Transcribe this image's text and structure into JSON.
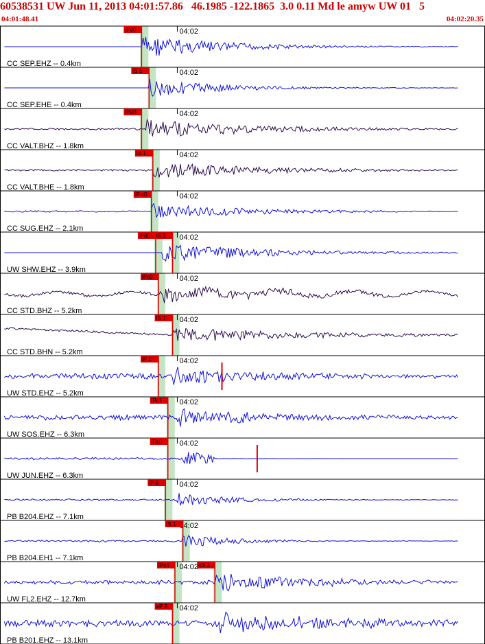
{
  "header": {
    "title": "60538531 UW Jun 11, 2013 04:01:57.86   46.1985 -122.1865  3.0 0.11 Md le amyw UW 01   5",
    "start_time": "04:01:48.41",
    "end_time": "04:02:20.35"
  },
  "colors": {
    "trace_blue": "#1010d8",
    "trace_dark": "#2a0a4a",
    "pick_red": "#dd0000",
    "window_green": "#b8e0b8",
    "grid_gray": "#808080"
  },
  "time_tick_label": "04:02",
  "traces": [
    {
      "label": "CC SEP.EHZ -- 0.4km",
      "color": "blue",
      "onset": 0.294,
      "amp": 0.62,
      "decay": 0.18,
      "noise": 0.0,
      "pre": "flat",
      "picks": [
        {
          "text": "iPd0",
          "t": 0.294
        }
      ],
      "flat_after": 0.0
    },
    {
      "label": "CC SEP.EHE -- 0.4km",
      "color": "blue",
      "onset": 0.31,
      "amp": 0.5,
      "decay": 0.16,
      "noise": 0.0,
      "pre": "flat",
      "picks": [
        {
          "text": "iS 1",
          "t": 0.31
        }
      ],
      "flat_after": 0.0
    },
    {
      "label": "CC VALT.BHZ -- 1.8km",
      "color": "dark",
      "onset": 0.304,
      "amp": 0.5,
      "decay": 0.25,
      "noise": 0.02,
      "pre": "noise",
      "picks": [
        {
          "text": "iPd0",
          "t": 0.294
        }
      ],
      "flat_after": 0.0
    },
    {
      "label": "CC VALT.BHE -- 1.8km",
      "color": "dark",
      "onset": 0.318,
      "amp": 0.45,
      "decay": 0.25,
      "noise": 0.02,
      "pre": "noise",
      "picks": [
        {
          "text": "iS 1",
          "t": 0.318
        }
      ],
      "flat_after": 0.0
    },
    {
      "label": "CC SUG.EHZ -- 2.1km",
      "color": "blue",
      "onset": 0.315,
      "amp": 0.45,
      "decay": 0.2,
      "noise": 0.01,
      "pre": "noise",
      "picks": [
        {
          "text": "iP c0",
          "t": 0.315
        }
      ],
      "flat_after": 0.0
    },
    {
      "label": "UW SHW.EHZ -- 3.9km",
      "color": "blue",
      "onset": 0.338,
      "amp": 0.5,
      "decay": 0.22,
      "noise": 0.0,
      "pre": "flat",
      "picks": [
        {
          "text": "iPd0",
          "t": 0.324
        },
        {
          "text": "iS 1",
          "t": 0.36
        }
      ],
      "flat_after": 0.0
    },
    {
      "label": "CC STD.BHZ -- 5.2km",
      "color": "dark",
      "onset": 0.33,
      "amp": 0.4,
      "decay": 0.3,
      "noise": 0.05,
      "pre": "wave",
      "picks": [
        {
          "text": "iPc0",
          "t": 0.33
        }
      ],
      "flat_after": 0.0
    },
    {
      "label": "CC STD.BHN -- 5.2km",
      "color": "dark",
      "onset": 0.36,
      "amp": 0.42,
      "decay": 0.28,
      "noise": 0.04,
      "pre": "drift",
      "picks": [
        {
          "text": "iS 1",
          "t": 0.36
        }
      ],
      "flat_after": 0.0
    },
    {
      "label": "UW STD.EHZ -- 5.2km",
      "color": "blue",
      "onset": 0.36,
      "amp": 0.45,
      "decay": 0.25,
      "noise": 0.12,
      "pre": "noise",
      "picks": [
        {
          "text": "iP 1",
          "t": 0.33
        }
      ],
      "flat_after": 0.0,
      "spike": 0.465
    },
    {
      "label": "UW SOS.EHZ -- 6.3km",
      "color": "blue",
      "onset": 0.37,
      "amp": 0.45,
      "decay": 0.25,
      "noise": 0.1,
      "pre": "noise",
      "picks": [
        {
          "text": "iPc1",
          "t": 0.35
        }
      ],
      "flat_after": 0.0
    },
    {
      "label": "UW JUN.EHZ -- 6.3km",
      "color": "blue",
      "onset": 0.38,
      "amp": 0.35,
      "decay": 0.15,
      "noise": 0.03,
      "pre": "noise",
      "picks": [
        {
          "text": "iPc0",
          "t": 0.35
        }
      ],
      "flat_after": 0.45,
      "spike": 0.54
    },
    {
      "label": "PB B204.EHZ -- 7.1km",
      "color": "blue",
      "onset": 0.37,
      "amp": 0.4,
      "decay": 0.12,
      "noise": 0.02,
      "pre": "noise",
      "picks": [
        {
          "text": "iP 0",
          "t": 0.345
        }
      ],
      "flat_after": 0.0
    },
    {
      "label": "PB B204.EH1 -- 7.1km",
      "color": "blue",
      "onset": 0.382,
      "amp": 0.35,
      "decay": 0.12,
      "noise": 0.02,
      "pre": "noise",
      "picks": [
        {
          "text": "iS 1",
          "t": 0.382
        }
      ],
      "flat_after": 0.0
    },
    {
      "label": "UW FL2.EHZ -- 12.7km",
      "color": "blue",
      "onset": 0.44,
      "amp": 0.5,
      "decay": 0.25,
      "noise": 0.08,
      "pre": "noise",
      "picks": [
        {
          "text": "iPd1",
          "t": 0.365
        },
        {
          "text": "eS 2",
          "t": 0.45
        }
      ],
      "flat_after": 0.0
    },
    {
      "label": "PB B201.EHZ -- 13.1km",
      "color": "blue",
      "onset": 0.46,
      "amp": 0.55,
      "decay": 0.3,
      "noise": 0.14,
      "pre": "noise",
      "picks": [
        {
          "text": "eP 2",
          "t": 0.36
        }
      ],
      "flat_after": 0.0
    }
  ]
}
